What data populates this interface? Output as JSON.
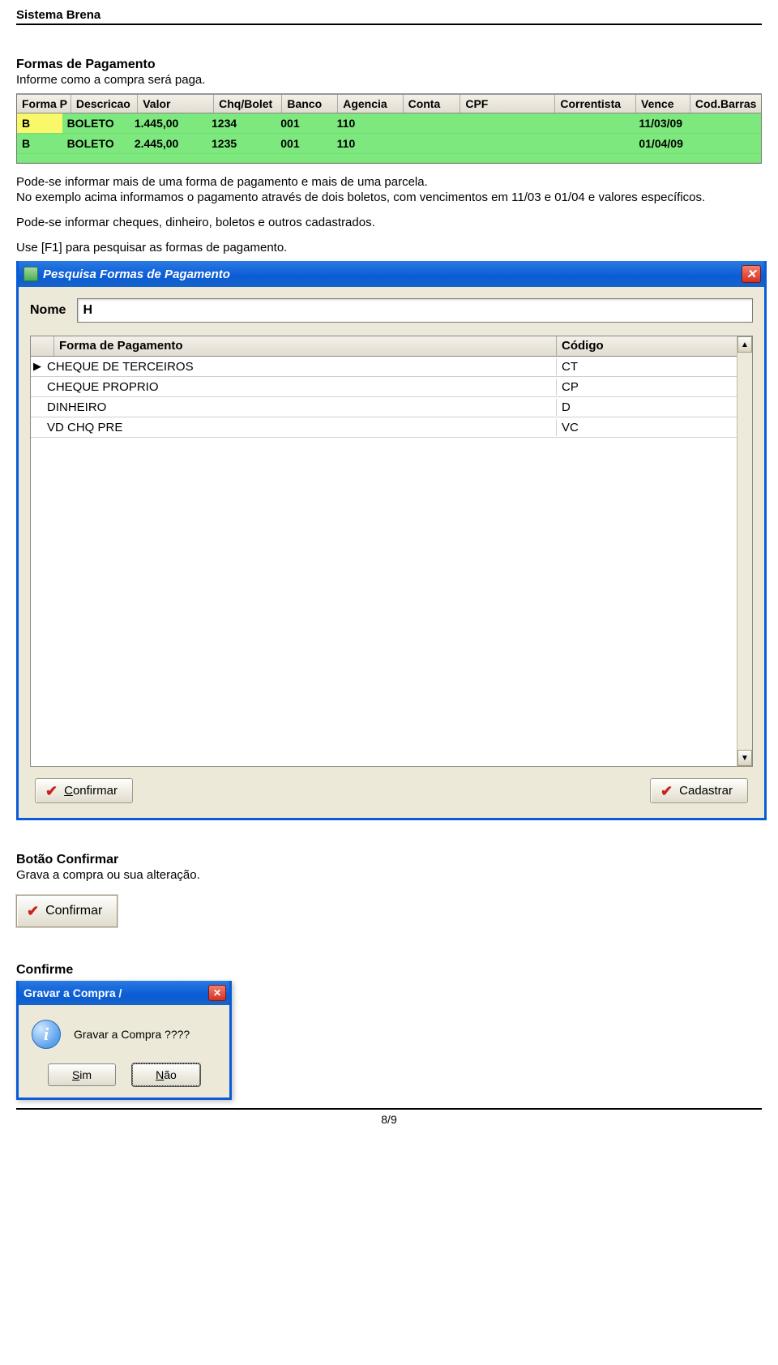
{
  "header": {
    "title": "Sistema Brena"
  },
  "section1": {
    "heading": "Formas de Pagamento",
    "subtitle": "Informe como a compra será paga."
  },
  "pay_table": {
    "columns": [
      "Forma P",
      "Descricao",
      "Valor",
      "Chq/Bolet",
      "Banco",
      "Agencia",
      "Conta",
      "CPF",
      "Correntista",
      "Vence",
      "Cod.Barras"
    ],
    "rows": [
      {
        "forma": "B",
        "desc": "BOLETO",
        "valor": "1.445,00",
        "chq": "1234",
        "banco": "001",
        "ag": "110",
        "conta": "",
        "cpf": "",
        "corr": "",
        "vence": "11/03/09",
        "cod": ""
      },
      {
        "forma": "B",
        "desc": "BOLETO",
        "valor": "2.445,00",
        "chq": "1235",
        "banco": "001",
        "ag": "110",
        "conta": "",
        "cpf": "",
        "corr": "",
        "vence": "01/04/09",
        "cod": ""
      }
    ]
  },
  "explain": {
    "p1": "Pode-se informar mais de uma forma de pagamento e mais de uma parcela.",
    "p2": "No exemplo acima informamos o pagamento através de dois boletos, com vencimentos em 11/03 e 01/04 e valores específicos.",
    "p3": "Pode-se informar cheques,  dinheiro, boletos e outros cadastrados.",
    "p4": "Use [F1] para pesquisar as formas de pagamento."
  },
  "search_win": {
    "title": "Pesquisa Formas de Pagamento",
    "nome_label": "Nome",
    "nome_value": "H",
    "columns": {
      "forma": "Forma de Pagamento",
      "codigo": "Código"
    },
    "rows": [
      {
        "forma": "CHEQUE DE TERCEIROS",
        "codigo": "CT"
      },
      {
        "forma": "CHEQUE PROPRIO",
        "codigo": "CP"
      },
      {
        "forma": "DINHEIRO",
        "codigo": "D"
      },
      {
        "forma": "VD CHQ PRE",
        "codigo": "VC"
      }
    ],
    "btn_confirmar_first": "C",
    "btn_confirmar_rest": "onfirmar",
    "btn_cadastrar": "Cadastrar"
  },
  "section2": {
    "heading": "Botão Confirmar",
    "text": "Grava a compra ou sua alteração.",
    "btn_first": "C",
    "btn_rest": "onfirmar"
  },
  "section3": {
    "heading": "Confirme"
  },
  "dialog": {
    "title": "Gravar a Compra /",
    "message": "Gravar a Compra ????",
    "sim_first": "S",
    "sim_rest": "im",
    "nao_first": "N",
    "nao_rest": "ão"
  },
  "footer": {
    "page": "8/9"
  }
}
